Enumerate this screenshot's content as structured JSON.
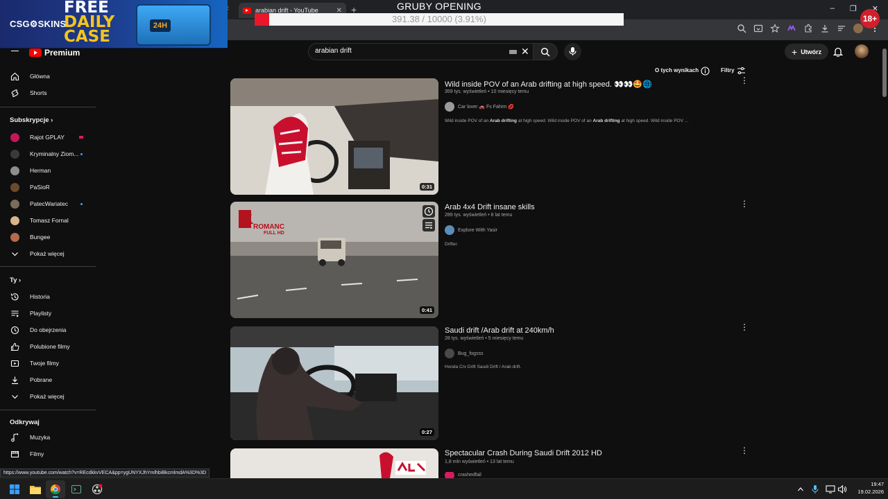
{
  "browser": {
    "tab_title": "arabian drift - YouTube",
    "tab_close": "✕",
    "new_tab": "+",
    "status_url": "https://www.youtube.com/watch?v=REcdkkvVECA&pp=ygUNYXJhYmlhbiBkcmlmdA%3D%3D"
  },
  "overlay": {
    "title": "GRUBY OPENING",
    "progress_text": "391.38 / 10000 (3.91%)",
    "progress_fraction": 0.0391,
    "age_badge": "18+",
    "banner_logo": "CSG⚙SKINS",
    "banner_promo_line1": "FREE",
    "banner_promo_line2": "DAILY",
    "banner_promo_line3": "CASE",
    "banner_case_label": "24H"
  },
  "header": {
    "logo_text": "Premium",
    "search_value": "arabian drift",
    "create_label": "Utwórz"
  },
  "filters": {
    "about_results": "O tych wynikach",
    "filters_label": "Filtry"
  },
  "sidebar": {
    "main": [
      {
        "label": "Główna",
        "icon": "home-icon"
      },
      {
        "label": "Shorts",
        "icon": "shorts-icon"
      }
    ],
    "subscriptions_title": "Subskrypcje",
    "subscriptions": [
      {
        "label": "Rajot GPLAY",
        "color": "#c2185b",
        "live": false
      },
      {
        "label": "Kryminalny Ziom...",
        "color": "#3a3a3a",
        "live": true
      },
      {
        "label": "Herman",
        "color": "#8d8d8d",
        "live": false
      },
      {
        "label": "PaSioR",
        "color": "#6b4a2b",
        "live": false
      },
      {
        "label": "PatecWariatec",
        "color": "#7b6b5b",
        "live": true
      },
      {
        "label": "Tomasz Fornal",
        "color": "#d7b48c",
        "live": false
      },
      {
        "label": "Bungee",
        "color": "#b56a4a",
        "live": false
      }
    ],
    "show_more_1": "Pokaż więcej",
    "you_title": "Ty",
    "you_items": [
      {
        "label": "Historia",
        "icon": "history-icon"
      },
      {
        "label": "Playlisty",
        "icon": "playlists-icon"
      },
      {
        "label": "Do obejrzenia",
        "icon": "watch-later-icon"
      },
      {
        "label": "Polubione filmy",
        "icon": "liked-icon"
      },
      {
        "label": "Twoje filmy",
        "icon": "your-videos-icon"
      },
      {
        "label": "Pobrane",
        "icon": "download-icon"
      }
    ],
    "show_more_2": "Pokaż więcej",
    "explore_title": "Odkrywaj",
    "explore_items": [
      {
        "label": "Muzyka",
        "icon": "music-icon"
      },
      {
        "label": "Filmy",
        "icon": "movies-icon"
      }
    ]
  },
  "results": [
    {
      "title": "Wild inside POV of an Arab drifting at high speed. 👀👀🤩🌐",
      "meta": "359 tys. wyświetleń • 10 miesięcy temu",
      "channel": "Car lover 🚗 Fs Fahim 💋",
      "desc_1": "Wild inside POV of an ",
      "desc_b1": "Arab drifting",
      "desc_2": " at high speed. Wild inside POV of an ",
      "desc_b2": "Arab drifting",
      "desc_3": " at high speed. Wild inside POV ...",
      "duration": "0:31"
    },
    {
      "title": "Arab 4x4 Drift insane skills",
      "meta": "289 tys. wyświetleń • 8 lat temu",
      "channel": "Explore With Yasir",
      "desc": "Drifter.",
      "duration": "0:41"
    },
    {
      "title": "Saudi drift /Arab drift at 240km/h",
      "meta": "28 tys. wyświetleń • 5 miesięcy temu",
      "channel": "Bug_fogsss",
      "desc": "Honda Crv Drift Saudi Drift / Arab drift.",
      "duration": "0:27"
    },
    {
      "title": "Spectacular Crash During Saudi Drift 2012 HD",
      "meta": "1,8 mln wyświetleń • 13 lat temu",
      "channel": "crashedfail"
    }
  ],
  "thumb2_logo": "ROMANC",
  "thumb2_logo_sub": "FULL HD",
  "taskbar": {
    "time": "19:47",
    "date": "19.02.2026"
  }
}
